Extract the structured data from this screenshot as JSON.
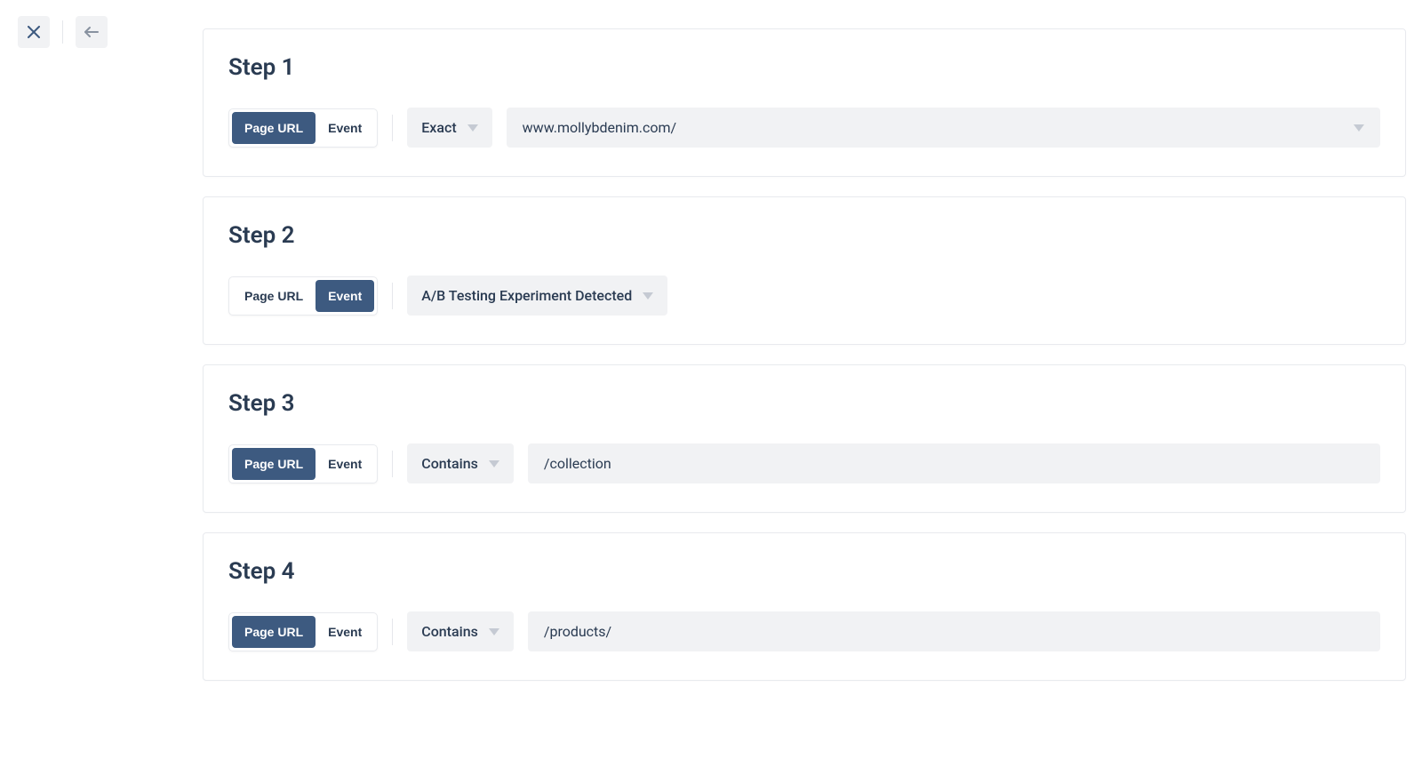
{
  "toggleLabels": {
    "pageUrl": "Page URL",
    "event": "Event"
  },
  "steps": [
    {
      "title": "Step 1",
      "activeToggle": "pageUrl",
      "matchType": "Exact",
      "value": "www.mollybdenim.com/",
      "showValueDropdown": true
    },
    {
      "title": "Step 2",
      "activeToggle": "event",
      "eventName": "A/B Testing Experiment Detected"
    },
    {
      "title": "Step 3",
      "activeToggle": "pageUrl",
      "matchType": "Contains",
      "value": "/collection",
      "showValueDropdown": false
    },
    {
      "title": "Step 4",
      "activeToggle": "pageUrl",
      "matchType": "Contains",
      "value": "/products/",
      "showValueDropdown": false
    }
  ]
}
